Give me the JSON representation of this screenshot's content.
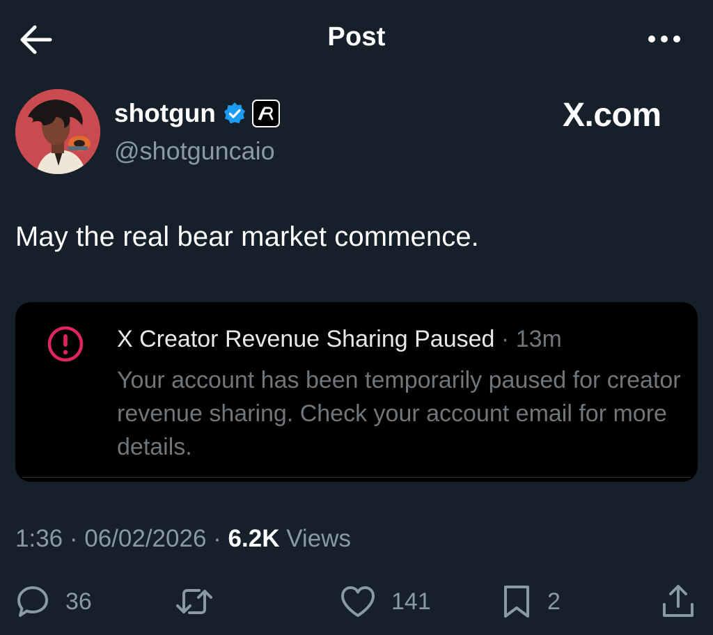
{
  "header": {
    "title": "Post"
  },
  "author": {
    "display_name": "shotgun",
    "handle": "@shotguncaio",
    "verified": true,
    "affiliate_badge_text": "R"
  },
  "watermark": {
    "text": "X.com"
  },
  "post": {
    "text": "May the real bear market commence."
  },
  "embedded_notification": {
    "title": "X Creator Revenue Sharing Paused",
    "separator": "·",
    "time": "13m",
    "body": "Your account has been temporarily paused for creator revenue sharing. Check your account email for more details."
  },
  "meta": {
    "time": "1:36",
    "date": "06/02/2026",
    "separator": "·",
    "views_count": "6.2K",
    "views_label": "Views"
  },
  "actions": {
    "replies": "36",
    "likes": "141",
    "bookmarks": "2"
  },
  "colors": {
    "background": "#15202b",
    "card_background": "#000000",
    "verified_blue": "#1d9bf0",
    "alert_red": "#e0245e",
    "muted_text": "#8b98a5"
  },
  "icons": [
    "back-arrow-icon",
    "more-dots-icon",
    "verified-icon",
    "alert-circle-icon",
    "reply-icon",
    "repost-icon",
    "like-icon",
    "bookmark-icon",
    "share-icon"
  ]
}
